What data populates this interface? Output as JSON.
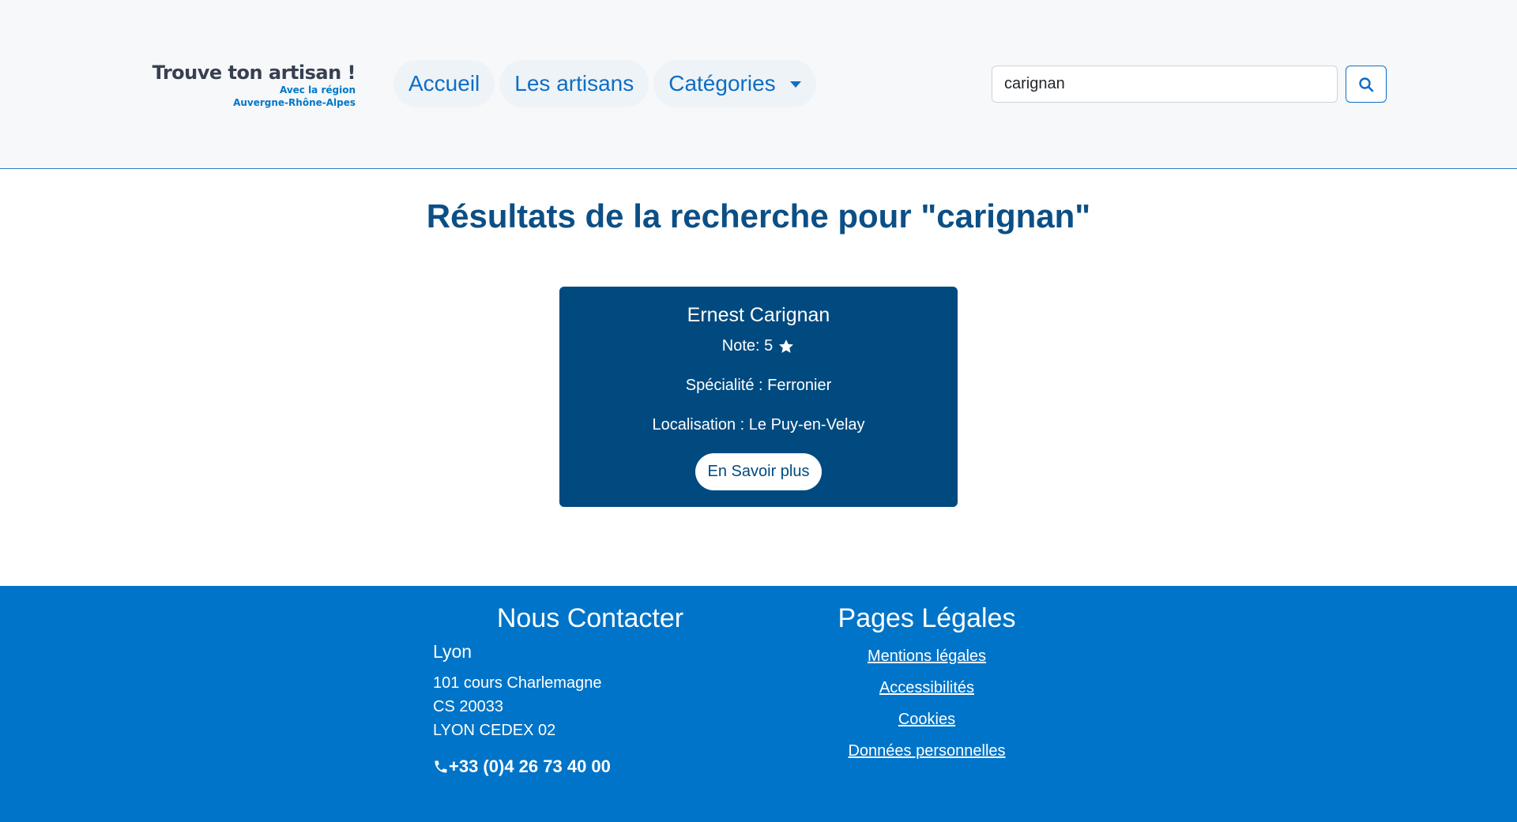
{
  "header": {
    "logo": {
      "title": "Trouve ton artisan !",
      "line1": "Avec la région",
      "line2": "Auvergne-Rhône-Alpes"
    },
    "nav": {
      "home": "Accueil",
      "artisans": "Les artisans",
      "categories": "Catégories"
    },
    "search": {
      "value": "carignan"
    }
  },
  "main": {
    "title": "Résultats de la recherche pour \"carignan\"",
    "results": [
      {
        "name": "Ernest Carignan",
        "rating_text": "Note: 5",
        "rating": 5,
        "specialty": "Spécialité : Ferronier",
        "location": "Localisation : Le Puy-en-Velay",
        "button": "En Savoir plus"
      }
    ]
  },
  "footer": {
    "contact": {
      "heading": "Nous Contacter",
      "city": "Lyon",
      "address": [
        "101 cours Charlemagne",
        "CS 20033",
        "LYON CEDEX 02"
      ],
      "phone": "+33 (0)4 26 73 40 00"
    },
    "legal": {
      "heading": "Pages Légales",
      "links": [
        "Mentions légales",
        "Accessibilités",
        "Cookies",
        "Données personnelles"
      ]
    }
  },
  "colors": {
    "header_bg": "#f6f8fa",
    "nav_text": "#0d6ec6",
    "title": "#0b4f86",
    "card_bg": "#004a80",
    "footer_bg": "#0074c8"
  },
  "icons": {
    "search": "magnifier-icon",
    "rating": "star-icon",
    "phone": "phone-icon",
    "dropdown": "caret-down-icon"
  }
}
